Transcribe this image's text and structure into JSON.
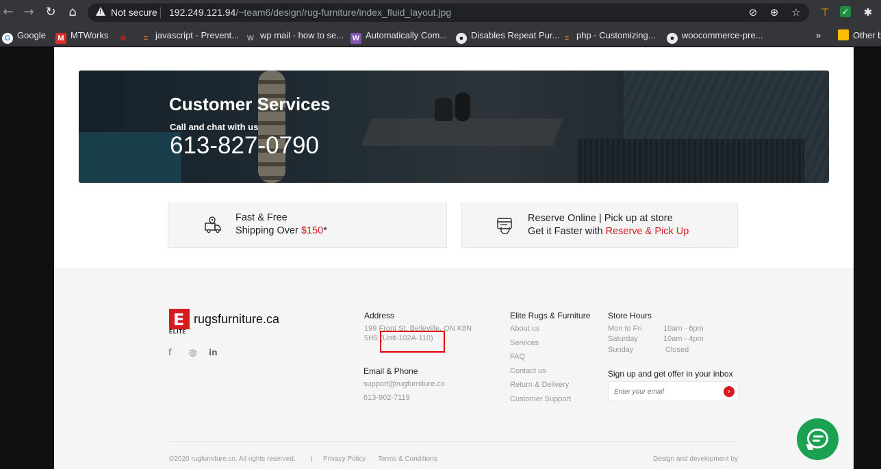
{
  "browser": {
    "security_label": "Not secure",
    "url_host": "192.249.121.94",
    "url_path": "/~team6/design/rug-furniture/index_fluid_layout.jpg",
    "bookmarks": [
      {
        "label": "Google",
        "icon": "google-icon"
      },
      {
        "label": "MTWorks",
        "icon": "mtworks-icon"
      },
      {
        "label": "",
        "icon": "w3-icon"
      },
      {
        "label": "javascript - Prevent...",
        "icon": "stackoverflow-icon"
      },
      {
        "label": "wp mail - how to se...",
        "icon": "wordpress-icon"
      },
      {
        "label": "Automatically Com...",
        "icon": "woo-icon"
      },
      {
        "label": "Disables Repeat Pur...",
        "icon": "github-icon"
      },
      {
        "label": "php - Customizing...",
        "icon": "stackoverflow-icon"
      },
      {
        "label": "woocommerce-pre...",
        "icon": "github-icon"
      }
    ],
    "other_bookmarks": "Other b",
    "more_chevron": "»"
  },
  "hero": {
    "title": "Customer Services",
    "subtitle": "Call and chat with us",
    "phone": "613-827-0790"
  },
  "features": {
    "shipping": {
      "line1": "Fast & Free",
      "line2_prefix": "Shipping Over ",
      "line2_highlight": "$150",
      "line2_suffix": "*"
    },
    "reserve": {
      "line1": "Reserve Online | Pick up at store",
      "line2_prefix": "Get it Faster with ",
      "line2_highlight": "Reserve & Pick Up"
    }
  },
  "footer": {
    "logo_word": "rugsfurniture.ca",
    "logo_elite": "ELITE",
    "logo_letter": "E",
    "social": [
      {
        "icon": "facebook-icon",
        "glyph": "f"
      },
      {
        "icon": "instagram-icon",
        "glyph": "◎"
      },
      {
        "icon": "linkedin-icon",
        "glyph": "in"
      }
    ],
    "address": {
      "heading": "Address",
      "line1": "199 Front St, Belleville, ON K8N",
      "line2": "5H5 (Unit-102A-110)"
    },
    "contact": {
      "heading": "Email & Phone",
      "email": "support@rugfurniture.co",
      "phone": "613-902-7119"
    },
    "links": {
      "heading": "Elite Rugs & Furniture",
      "items": [
        "About us",
        "Services",
        "FAQ",
        "Contact us",
        "Return & Delivery",
        "Customer Support"
      ]
    },
    "hours": {
      "heading": "Store Hours",
      "rows": [
        {
          "day": "Mon to Fri",
          "time": "10am - 6pm"
        },
        {
          "day": "Saturday",
          "time": "10am - 4pm"
        },
        {
          "day": "Sunday",
          "time": "Closed"
        }
      ]
    },
    "newsletter": {
      "heading": "Sign up and get offer in your inbox",
      "placeholder": "Enter your email"
    },
    "copyright": "©2020 rugfurniture.co. All rights reserved.",
    "separator": "|",
    "privacy": "Privacy Policy",
    "terms": "Terms & Conditions",
    "credit": "Design and development by"
  },
  "colors": {
    "accent": "#d71920",
    "chat": "#1aa251",
    "highlight_box": "#e00000"
  }
}
